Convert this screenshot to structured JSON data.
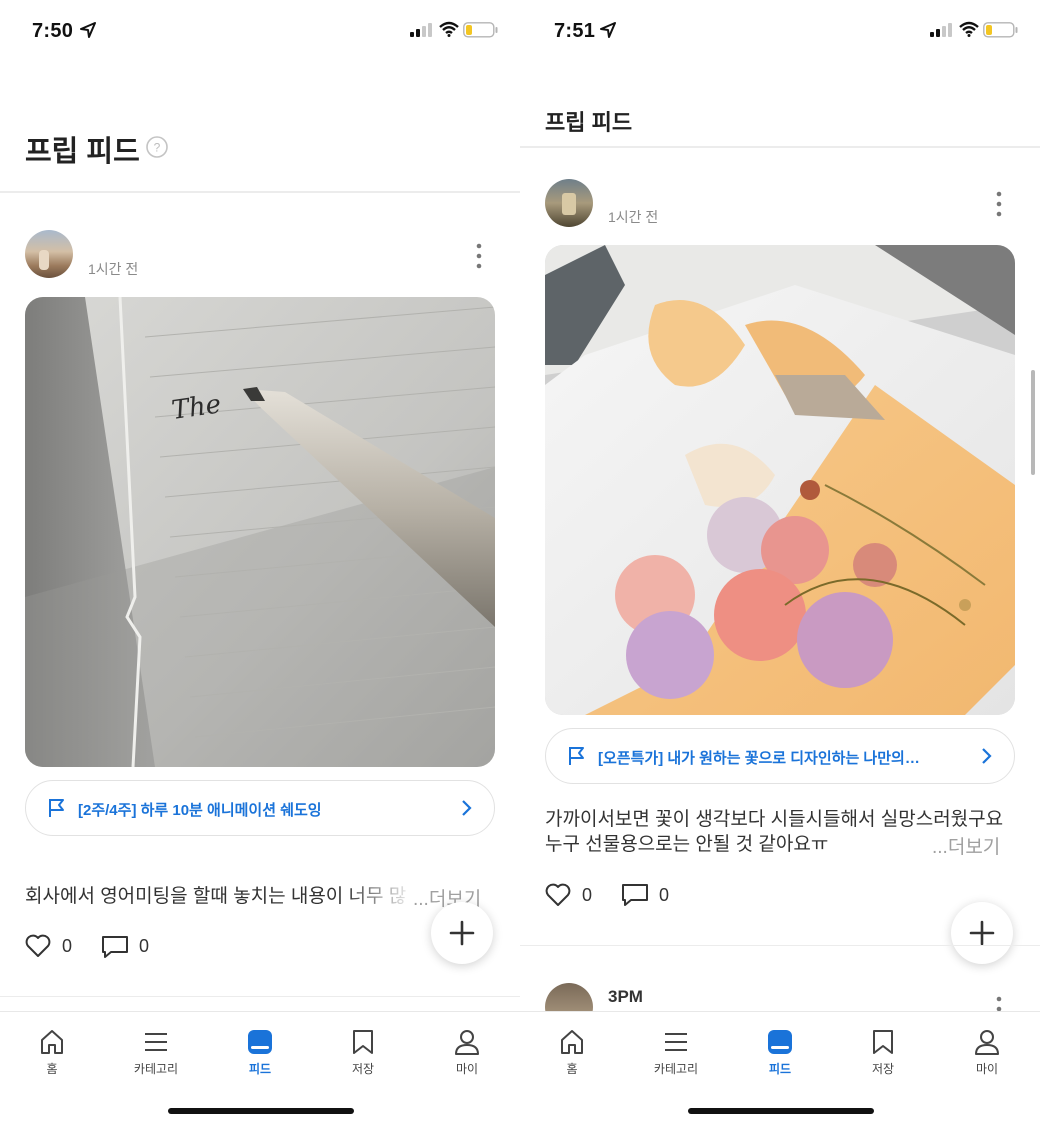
{
  "colors": {
    "accent": "#1a73d9",
    "text": "#222222",
    "muted": "#8a8a8a",
    "divider": "#ececec"
  },
  "left": {
    "status": {
      "time": "7:50"
    },
    "header": {
      "title": "프립 피드",
      "help_icon": "question-circle-icon"
    },
    "post": {
      "time_ago": "1시간 전",
      "product_label": "[2주/4주] 하루 10분 애니메이션 쉐도잉",
      "caption": "회사에서 영어미팅을 할때 놓치는 내용이 너무 많",
      "more_label": "...더보기",
      "likes": "0",
      "comments": "0",
      "photo_text": "The"
    }
  },
  "right": {
    "status": {
      "time": "7:51"
    },
    "header": {
      "title": "프립 피드"
    },
    "post": {
      "time_ago": "1시간 전",
      "product_label": "[오픈특가] 내가 원하는 꽃으로 디자인하는 나만의…",
      "caption_line1": "가까이서보면 꽃이 생각보다 시들시들해서 실망스러웠구요",
      "caption_line2": "누구 선물용으로는 안될 것 같아요ㅠ",
      "more_label": "...더보기",
      "likes": "0",
      "comments": "0"
    },
    "next_post": {
      "author": "3PM"
    }
  },
  "nav": {
    "items": [
      {
        "label": "홈",
        "icon": "home-icon"
      },
      {
        "label": "카테고리",
        "icon": "menu-icon"
      },
      {
        "label": "피드",
        "icon": "feed-icon"
      },
      {
        "label": "저장",
        "icon": "bookmark-icon"
      },
      {
        "label": "마이",
        "icon": "person-icon"
      }
    ],
    "active_index": 2
  }
}
